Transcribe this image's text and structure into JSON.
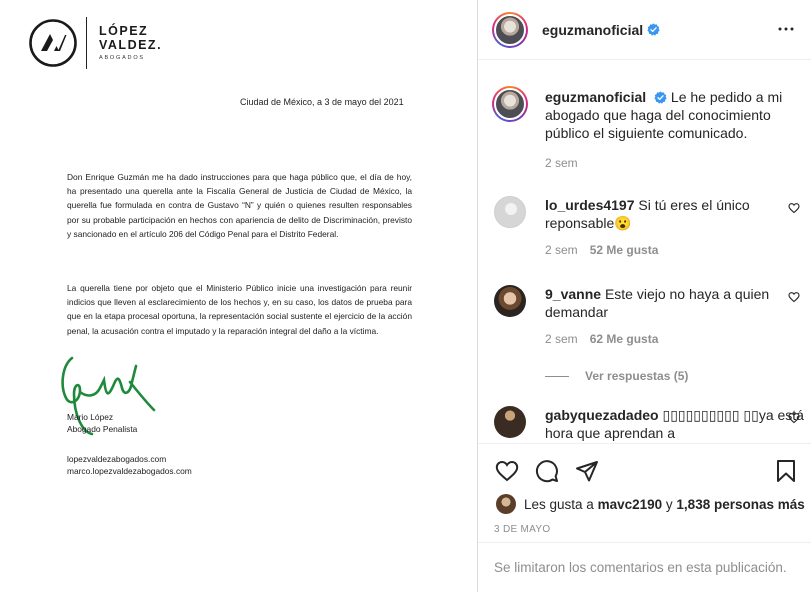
{
  "document": {
    "logo_line1": "LÓPEZ",
    "logo_line2": "VALDEZ.",
    "logo_sub": "ABOGADOS",
    "date": "Ciudad de México, a 3 de mayo del 2021",
    "paragraph1": "Don Enrique Guzmán me ha dado instrucciones para que haga público que, el día de hoy, ha presentado una querella ante la Fiscalía General de Justicia de Ciudad de México, la querella fue formulada en contra de Gustavo “N” y quién o quienes resulten responsables por su probable participación en hechos con apariencia de delito de Discriminación, previsto y sancionado en el artículo 206 del Código Penal para el Distrito Federal.",
    "paragraph2": "La querella tiene por objeto que el Ministerio Público inicie una investigación para reunir indicios que lleven al esclarecimiento de los hechos y, en su caso, los datos de prueba para que en la etapa procesal oportuna, la representación social sustente el ejercicio de la acción penal, la acusación contra el imputado y la reparación integral del daño a la víctima.",
    "signer_name": "Mario López",
    "signer_title": "Abogado Penalista",
    "web1": "lopezvaldezabogados.com",
    "web2": "marco.lopezvaldezabogados.com"
  },
  "post": {
    "username": "eguzmanoficial",
    "caption_user": "eguzmanoficial",
    "caption_text": "Le he pedido a mi abogado que haga del conocimiento público el siguiente comunicado.",
    "caption_time": "2 sem",
    "comments": [
      {
        "user": "lo_urdes4197",
        "text": "Si tú eres el único reponsable😮",
        "time": "2 sem",
        "likes": "52 Me gusta"
      },
      {
        "user": "9_vanne",
        "text": "Este viejo no haya a quien demandar",
        "time": "2 sem",
        "likes": "62 Me gusta"
      },
      {
        "user": "gabyquezadadeo",
        "text": "▯▯▯▯▯▯▯▯▯▯ ▯▯ya está hora que aprendan a",
        "time": "",
        "likes": ""
      }
    ],
    "view_replies": "Ver respuestas (5)",
    "likes_prefix": "Les gusta a",
    "likes_user": "mavc2190",
    "likes_mid": "y",
    "likes_count": "1,838 personas más",
    "date": "3 DE MAYO",
    "comments_limited": "Se limitaron los comentarios en esta publicación.",
    "colors": {
      "verified": "#3897f0",
      "muted": "#8e8e8e",
      "text": "#262626"
    }
  }
}
